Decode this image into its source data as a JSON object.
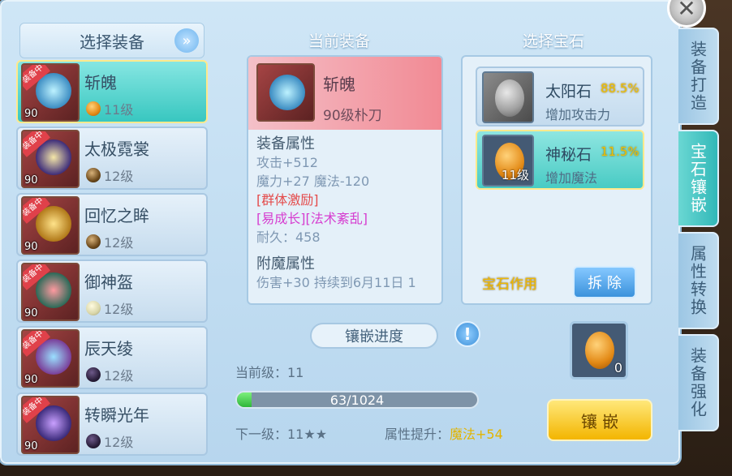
{
  "left": {
    "title": "选择装备",
    "items": [
      {
        "name": "斩魄",
        "level": "90",
        "tag": "装备中",
        "gem_level": "11级",
        "selected": true,
        "gem_color": "#e38a16"
      },
      {
        "name": "太极霓裳",
        "level": "90",
        "tag": "装备中",
        "gem_level": "12级",
        "selected": false,
        "gem_color": "#6d4a1c"
      },
      {
        "name": "回忆之眸",
        "level": "90",
        "tag": "装备中",
        "gem_level": "12级",
        "selected": false,
        "gem_color": "#6d4a1c"
      },
      {
        "name": "御神盔",
        "level": "90",
        "tag": "装备中",
        "gem_level": "12级",
        "selected": false,
        "gem_color": "#d9d6a8"
      },
      {
        "name": "辰天绫",
        "level": "90",
        "tag": "装备中",
        "gem_level": "12级",
        "selected": false,
        "gem_color": "#2a1f3b"
      },
      {
        "name": "转瞬光年",
        "level": "90",
        "tag": "装备中",
        "gem_level": "12级",
        "selected": false,
        "gem_color": "#2a1f3b"
      }
    ]
  },
  "middle": {
    "title": "当前装备",
    "name": "斩魄",
    "sub": "90级朴刀",
    "attr_head": "装备属性",
    "attrs": {
      "atk": "攻击+512",
      "mag": "魔力+27 魔法-120",
      "effect1": "[群体激励]",
      "effect2": "[易成长][法术紊乱]",
      "durability": "耐久：458"
    },
    "enchant_head": "附魔属性",
    "enchant_line": "伤害+30 持续到6月11日 1"
  },
  "right": {
    "title": "选择宝石",
    "gems": [
      {
        "name": "太阳石",
        "pct": "88.5%",
        "desc": "增加攻击力",
        "level": "",
        "selected": false
      },
      {
        "name": "神秘石",
        "pct": "11.5%",
        "desc": "增加魔法",
        "level": "11级",
        "selected": true
      }
    ],
    "effect_label": "宝石作用",
    "remove_label": "拆 除"
  },
  "progress": {
    "title": "镶嵌进度",
    "current_level": "当前级：11",
    "bar_text": "63/1024",
    "fraction": 0.0615,
    "next_level": "下一级：11★★",
    "attr_up_label": "属性提升：",
    "attr_up_value": "魔法+54",
    "slot_count": "0",
    "inlay_label": "镶 嵌"
  },
  "side_tabs": [
    {
      "label": "装备打造",
      "active": false
    },
    {
      "label": "宝石镶嵌",
      "active": true
    },
    {
      "label": "属性转换",
      "active": false
    },
    {
      "label": "装备强化",
      "active": false
    }
  ],
  "colors": {
    "accent": "#3bc4bf",
    "gold": "#f0c000",
    "red_text": "#e44a4a",
    "pink_text": "#d63dd0"
  }
}
